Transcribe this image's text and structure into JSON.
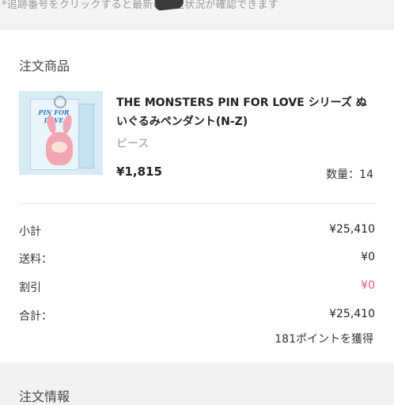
{
  "top_note": "*追跡番号をクリックすると最新の配送状況が確認できます",
  "order_section": {
    "title": "注文商品",
    "item": {
      "name": "THE MONSTERS PIN FOR LOVE シリーズ ぬいぐるみペンダント(N-Z)",
      "variant": "ピース",
      "price": "¥1,815",
      "qty_label": "数量：",
      "qty_value": "14",
      "thumbnail_text": "PIN FOR LOVE"
    }
  },
  "summary": {
    "subtotal_label": "小計",
    "subtotal_value": "¥25,410",
    "shipping_label": "送料：",
    "shipping_value": "¥0",
    "discount_label": "割引",
    "discount_value": "¥0",
    "total_label": "合計：",
    "total_value": "¥25,410",
    "points_text": "181ポイントを獲得"
  },
  "next_section_title": "注文情報",
  "colors": {
    "discount": "#e05a6e",
    "muted": "#999999",
    "page_bg": "#f2f2f2"
  }
}
